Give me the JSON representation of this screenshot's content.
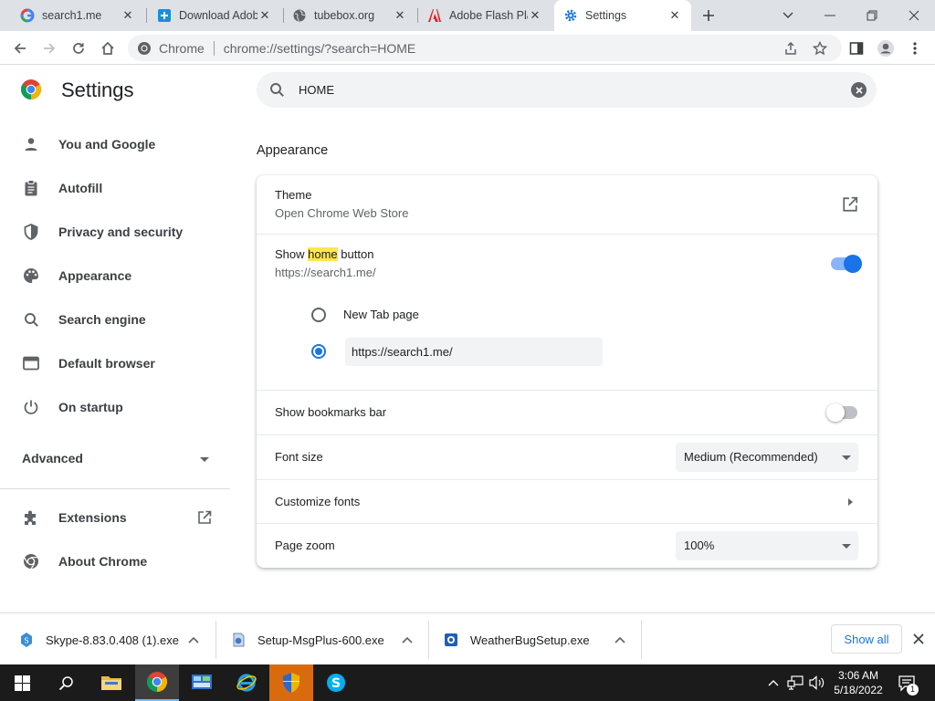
{
  "browser": {
    "tabs": [
      {
        "title": "search1.me",
        "icon": "google-g-icon"
      },
      {
        "title": "Download Adob",
        "icon": "plus-box-icon"
      },
      {
        "title": "tubebox.org",
        "icon": "globe-icon"
      },
      {
        "title": "Adobe Flash Pla",
        "icon": "adobe-icon"
      },
      {
        "title": "Settings",
        "icon": "gear-icon",
        "active": true
      }
    ],
    "omnibox": {
      "site_name": "Chrome",
      "url": "chrome://settings/?search=HOME"
    }
  },
  "settings": {
    "title": "Settings",
    "search_query": "HOME",
    "nav": [
      {
        "label": "You and Google",
        "icon": "person-icon"
      },
      {
        "label": "Autofill",
        "icon": "clipboard-icon"
      },
      {
        "label": "Privacy and security",
        "icon": "shield-icon"
      },
      {
        "label": "Appearance",
        "icon": "palette-icon"
      },
      {
        "label": "Search engine",
        "icon": "search-icon"
      },
      {
        "label": "Default browser",
        "icon": "browser-window-icon"
      },
      {
        "label": "On startup",
        "icon": "power-icon"
      }
    ],
    "advanced_label": "Advanced",
    "nav_bottom": [
      {
        "label": "Extensions",
        "icon": "puzzle-icon"
      },
      {
        "label": "About Chrome",
        "icon": "chrome-icon"
      }
    ],
    "section_title": "Appearance",
    "theme": {
      "label": "Theme",
      "sublabel": "Open Chrome Web Store"
    },
    "home_button": {
      "label_before": "Show ",
      "label_highlight": "home",
      "label_after": " button",
      "sublabel": "https://search1.me/",
      "enabled": true,
      "option_newtab": "New Tab page",
      "custom_url": "https://search1.me/"
    },
    "bookmarks_bar": {
      "label": "Show bookmarks bar",
      "enabled": false
    },
    "font_size": {
      "label": "Font size",
      "value": "Medium (Recommended)"
    },
    "customize_fonts": {
      "label": "Customize fonts"
    },
    "page_zoom": {
      "label": "Page zoom",
      "value": "100%"
    }
  },
  "downloads": {
    "items": [
      {
        "name": "Skype-8.83.0.408 (1).exe",
        "icon": "skype-file-icon"
      },
      {
        "name": "Setup-MsgPlus-600.exe",
        "icon": "msgplus-file-icon"
      },
      {
        "name": "WeatherBugSetup.exe",
        "icon": "weatherbug-file-icon"
      }
    ],
    "show_all": "Show all"
  },
  "taskbar": {
    "time": "3:06 AM",
    "date": "5/18/2022",
    "notification_count": "1"
  },
  "colors": {
    "accent": "#1a73e8",
    "highlight": "#fde74c",
    "taskbar": "#1b1b1b"
  }
}
